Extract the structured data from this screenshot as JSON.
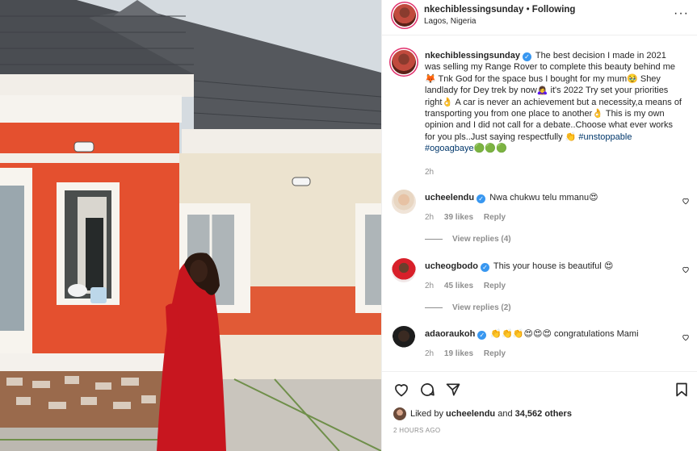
{
  "post": {
    "username": "nkechiblessingsunday",
    "dot": "•",
    "follow_status": "Following",
    "location": "Lagos, Nigeria"
  },
  "caption": {
    "username": "nkechiblessingsunday",
    "text": "The best decision I made in 2021 was selling my Range Rover to complete this beauty behind me🦊 Tnk God for the space bus I bought for my mum🥹 Shey landlady for Dey trek by now🙇‍♀️ it's 2022 Try set your priorities right👌 A car is never an achievement but a necessity,a means of transporting you from one place to another👌 This is my own opinion and I did not call for a debate..Choose what ever works for you pls..Just saying respectfully 👏",
    "hashtag1": "#unstoppable",
    "hashtag2": "#ogoagbaye",
    "emoji_tail": "🟢🟢🟢",
    "time": "2h"
  },
  "comments": [
    {
      "username": "ucheelendu",
      "text": "Nwa chukwu telu mmanu😍",
      "time": "2h",
      "likes": "39 likes",
      "reply": "Reply",
      "view_replies": "View replies (4)"
    },
    {
      "username": "ucheogbodo",
      "text": "This your house is beautiful 😍",
      "time": "2h",
      "likes": "45 likes",
      "reply": "Reply",
      "view_replies": "View replies (2)"
    },
    {
      "username": "adaoraukoh",
      "text": "👏👏👏😍😍😍 congratulations Mami",
      "time": "2h",
      "likes": "19 likes",
      "reply": "Reply"
    }
  ],
  "footer": {
    "liked_prefix": "Liked by ",
    "liked_user": "ucheelendu",
    "liked_mid": " and ",
    "liked_count": "34,562 others",
    "posted_ago": "2 HOURS AGO"
  },
  "icons": {
    "verified": "✓",
    "more": "···",
    "like": "heart-icon",
    "comment": "comment-icon",
    "share": "paper-plane-icon",
    "save": "bookmark-icon"
  },
  "colors": {
    "accent_link": "#00376b",
    "verified_blue": "#3897f0",
    "muted": "#8e8e8e",
    "house_orange": "#e8502f",
    "dress_red": "#c8161f"
  }
}
